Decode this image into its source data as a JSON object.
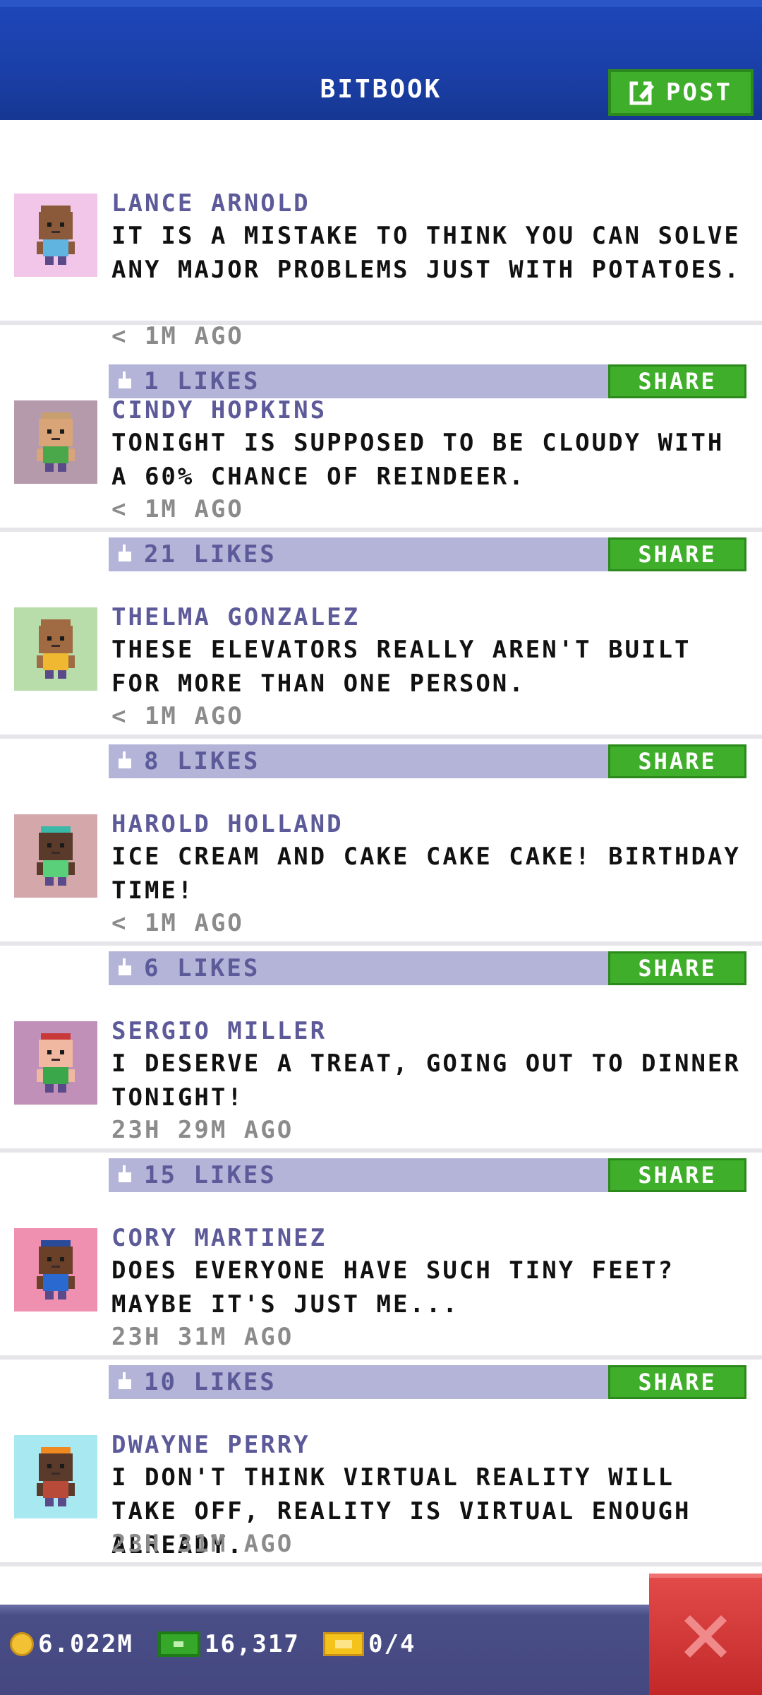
{
  "header": {
    "title": "BITBOOK",
    "post_label": "POST"
  },
  "posts": [
    {
      "name": "LANCE ARNOLD",
      "message": "IT IS A MISTAKE TO THINK YOU CAN SOLVE ANY MAJOR PROBLEMS JUST WITH POTATOES.",
      "time": "< 1M AGO",
      "likes": "1 LIKES",
      "share": "SHARE",
      "avatar_bg": "#f2c6e8",
      "skin": "#8a5a3a",
      "shirt": "#5fb4e0",
      "hair": "#8a5a3a"
    },
    {
      "name": "CINDY HOPKINS",
      "message": "TONIGHT IS SUPPOSED TO BE CLOUDY WITH A 60% CHANCE OF REINDEER.",
      "time": "< 1M AGO",
      "likes": "21 LIKES",
      "share": "SHARE",
      "avatar_bg": "#b59aab",
      "skin": "#d8a478",
      "shirt": "#4aa84a",
      "hair": "#c8a070"
    },
    {
      "name": "THELMA GONZALEZ",
      "message": "THESE ELEVATORS REALLY AREN'T BUILT FOR MORE THAN ONE PERSON.",
      "time": "< 1M AGO",
      "likes": "8 LIKES",
      "share": "SHARE",
      "avatar_bg": "#b8ddaa",
      "skin": "#a06a42",
      "shirt": "#f0b830",
      "hair": "#a06a42"
    },
    {
      "name": "HAROLD HOLLAND",
      "message": "ICE CREAM AND CAKE CAKE CAKE! BIRTHDAY TIME!",
      "time": "< 1M AGO",
      "likes": "6 LIKES",
      "share": "SHARE",
      "avatar_bg": "#d4a8aa",
      "skin": "#5a3a2a",
      "shirt": "#5ad07a",
      "hair": "#3ab8a8"
    },
    {
      "name": "SERGIO MILLER",
      "message": "I DESERVE A TREAT, GOING OUT TO DINNER TONIGHT!",
      "time": "23H 29M AGO",
      "likes": "15 LIKES",
      "share": "SHARE",
      "avatar_bg": "#c090b8",
      "skin": "#f0b8a0",
      "shirt": "#3aa84a",
      "hair": "#c83a3a"
    },
    {
      "name": "CORY MARTINEZ",
      "message": "DOES EVERYONE HAVE SUCH TINY FEET? MAYBE IT'S JUST ME...",
      "time": "23H 31M AGO",
      "likes": "10 LIKES",
      "share": "SHARE",
      "avatar_bg": "#f090b0",
      "skin": "#6a4028",
      "shirt": "#2a6ad0",
      "hair": "#2a4a9a"
    },
    {
      "name": "DWAYNE PERRY",
      "message": "I DON'T THINK VIRTUAL REALITY WILL TAKE OFF, REALITY IS VIRTUAL ENOUGH ALREADY.",
      "time": "23H 31M AGO",
      "likes": "",
      "share": "",
      "avatar_bg": "#a8e8f0",
      "skin": "#5a3a2a",
      "shirt": "#b84a3a",
      "hair": "#f08a20"
    }
  ],
  "footer": {
    "coins": "6.022M",
    "bux": "16,317",
    "tickets": "0/4"
  }
}
